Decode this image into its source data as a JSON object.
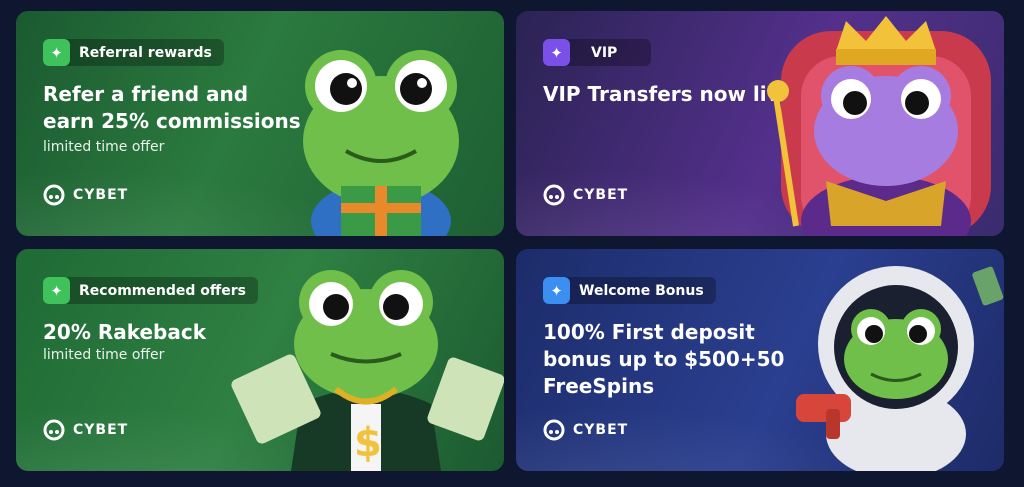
{
  "cards": [
    {
      "badge": "Referral rewards",
      "title": "Refer a friend and earn 25% commissions",
      "subtitle": "limited time offer",
      "brand": "CYBET",
      "badge_color": "#3fc25b"
    },
    {
      "badge": "VIP",
      "title": "VIP Transfers now live",
      "subtitle": "",
      "brand": "CYBET",
      "badge_color": "#7a50e8"
    },
    {
      "badge": "Recommended offers",
      "title": "20% Rakeback",
      "subtitle": "limited time offer",
      "brand": "CYBET",
      "badge_color": "#3fc25b"
    },
    {
      "badge": "Welcome Bonus",
      "title": "100% First deposit bonus up to $500+50 FreeSpins",
      "subtitle": "",
      "brand": "CYBET",
      "badge_color": "#3b8ff0"
    }
  ],
  "icons": {
    "badge": "sparkle-icon",
    "brand": "cybet-logo-icon"
  }
}
